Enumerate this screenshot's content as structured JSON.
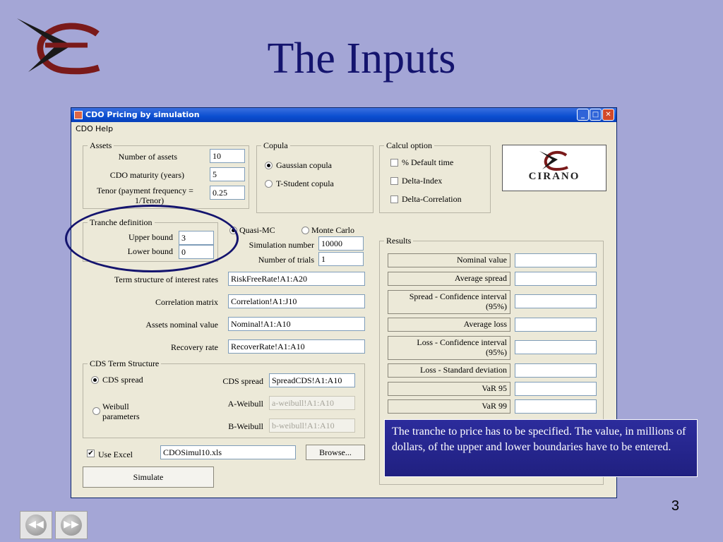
{
  "slide": {
    "title": "The Inputs",
    "page_number": "3",
    "note": "The tranche to price has to be specified. The value, in millions of dollars, of the upper and lower boundaries have to be entered.",
    "nav": {
      "prev_glyph": "◀◀",
      "next_glyph": "▶▶"
    }
  },
  "window": {
    "title": "CDO Pricing by simulation",
    "controls": {
      "minimize": "_",
      "maximize": "□",
      "close": "✕"
    },
    "menu": [
      "CDO",
      "Help"
    ]
  },
  "assets": {
    "label": "Assets",
    "number_of_assets_label": "Number of assets",
    "number_of_assets": "10",
    "maturity_label": "CDO maturity (years)",
    "maturity": "5",
    "tenor_label_1": "Tenor (payment frequency =",
    "tenor_label_2": "1/Tenor)",
    "tenor": "0.25"
  },
  "copula": {
    "label": "Copula",
    "gaussian": "Gaussian copula",
    "tstudent": "T-Student copula",
    "selected": "gaussian"
  },
  "calcul": {
    "label": "Calcul option",
    "default_time": "% Default time",
    "delta_index": "Delta-Index",
    "delta_correlation": "Delta-Correlation"
  },
  "logo": {
    "text": "CIRANO"
  },
  "tranche": {
    "label": "Tranche definition",
    "upper_label": "Upper bound",
    "upper": "3",
    "lower_label": "Lower bound",
    "lower": "0"
  },
  "method": {
    "quasi_mc": "Quasi-MC",
    "monte_carlo": "Monte Carlo",
    "selected": "quasi_mc",
    "simulation_number_label": "Simulation number",
    "simulation_number": "10000",
    "trials_label": "Number of trials",
    "trials": "1"
  },
  "ranges": {
    "term_structure_label": "Term structure of interest rates",
    "term_structure": "RiskFreeRate!A1:A20",
    "correlation_label": "Correlation matrix",
    "correlation": "Correlation!A1:J10",
    "nominal_label": "Assets nominal value",
    "nominal": "Nominal!A1:A10",
    "recovery_label": "Recovery rate",
    "recovery": "RecoverRate!A1:A10"
  },
  "cds": {
    "label": "CDS Term Structure",
    "cds_spread_radio": "CDS spread",
    "weibull_radio_1": "Weibull",
    "weibull_radio_2": "parameters",
    "spread_label": "CDS spread",
    "spread": "SpreadCDS!A1:A10",
    "a_weibull_label": "A-Weibull",
    "a_weibull": "a-weibull!A1:A10",
    "b_weibull_label": "B-Weibull",
    "b_weibull": "b-weibull!A1:A10"
  },
  "excel": {
    "use_excel_label": "Use Excel",
    "checked_glyph": "✔",
    "file": "CDOSimul10.xls",
    "browse": "Browse..."
  },
  "simulate_label": "Simulate",
  "results": {
    "label": "Results",
    "rows": [
      "Nominal value",
      "Average spread",
      "Spread - Confidence interval",
      "(95%)",
      "Average loss",
      "Loss - Confidence interval",
      "(95%)",
      "Loss - Standard deviation",
      "VaR 95",
      "VaR 99"
    ]
  }
}
